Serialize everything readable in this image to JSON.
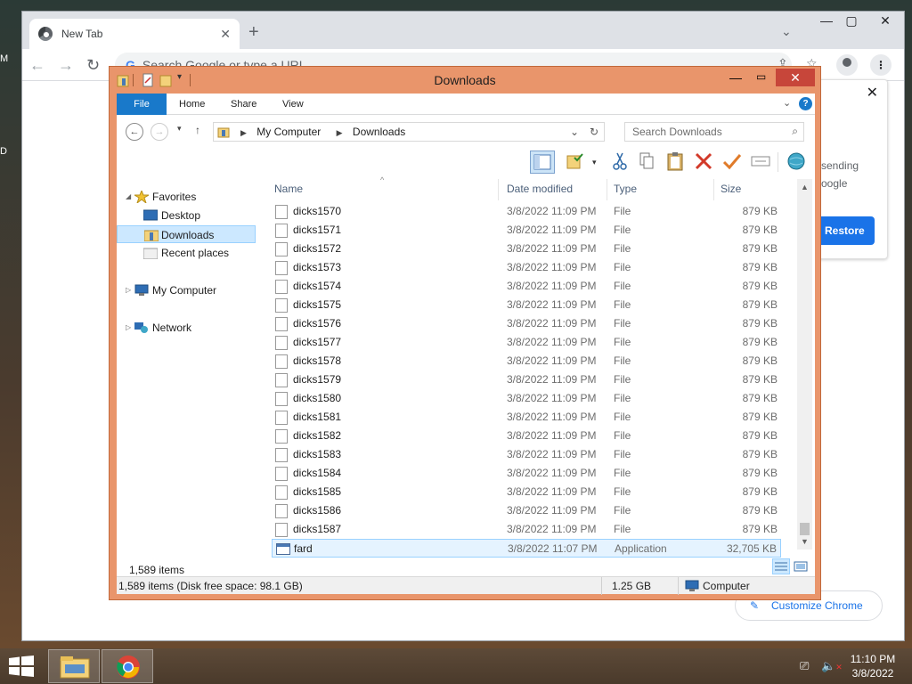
{
  "chrome": {
    "tab_title": "New Tab",
    "omnibox_placeholder": "Search Google or type a URL",
    "restore_text": [
      "sending",
      "oogle"
    ],
    "restore_label": "Restore",
    "customize_label": "Customize Chrome"
  },
  "explorer": {
    "title": "Downloads",
    "ribbon_tabs": [
      "File",
      "Home",
      "Share",
      "View"
    ],
    "breadcrumb": [
      "My Computer",
      "Downloads"
    ],
    "search_placeholder": "Search Downloads",
    "nav": {
      "favorites": "Favorites",
      "desktop": "Desktop",
      "downloads": "Downloads",
      "recent": "Recent places",
      "computer": "My Computer",
      "network": "Network"
    },
    "columns": {
      "name": "Name",
      "date": "Date modified",
      "type": "Type",
      "size": "Size"
    },
    "files": [
      {
        "name": "dicks1570",
        "date": "3/8/2022 11:09 PM",
        "type": "File",
        "size": "879 KB"
      },
      {
        "name": "dicks1571",
        "date": "3/8/2022 11:09 PM",
        "type": "File",
        "size": "879 KB"
      },
      {
        "name": "dicks1572",
        "date": "3/8/2022 11:09 PM",
        "type": "File",
        "size": "879 KB"
      },
      {
        "name": "dicks1573",
        "date": "3/8/2022 11:09 PM",
        "type": "File",
        "size": "879 KB"
      },
      {
        "name": "dicks1574",
        "date": "3/8/2022 11:09 PM",
        "type": "File",
        "size": "879 KB"
      },
      {
        "name": "dicks1575",
        "date": "3/8/2022 11:09 PM",
        "type": "File",
        "size": "879 KB"
      },
      {
        "name": "dicks1576",
        "date": "3/8/2022 11:09 PM",
        "type": "File",
        "size": "879 KB"
      },
      {
        "name": "dicks1577",
        "date": "3/8/2022 11:09 PM",
        "type": "File",
        "size": "879 KB"
      },
      {
        "name": "dicks1578",
        "date": "3/8/2022 11:09 PM",
        "type": "File",
        "size": "879 KB"
      },
      {
        "name": "dicks1579",
        "date": "3/8/2022 11:09 PM",
        "type": "File",
        "size": "879 KB"
      },
      {
        "name": "dicks1580",
        "date": "3/8/2022 11:09 PM",
        "type": "File",
        "size": "879 KB"
      },
      {
        "name": "dicks1581",
        "date": "3/8/2022 11:09 PM",
        "type": "File",
        "size": "879 KB"
      },
      {
        "name": "dicks1582",
        "date": "3/8/2022 11:09 PM",
        "type": "File",
        "size": "879 KB"
      },
      {
        "name": "dicks1583",
        "date": "3/8/2022 11:09 PM",
        "type": "File",
        "size": "879 KB"
      },
      {
        "name": "dicks1584",
        "date": "3/8/2022 11:09 PM",
        "type": "File",
        "size": "879 KB"
      },
      {
        "name": "dicks1585",
        "date": "3/8/2022 11:09 PM",
        "type": "File",
        "size": "879 KB"
      },
      {
        "name": "dicks1586",
        "date": "3/8/2022 11:09 PM",
        "type": "File",
        "size": "879 KB"
      },
      {
        "name": "dicks1587",
        "date": "3/8/2022 11:09 PM",
        "type": "File",
        "size": "879 KB"
      },
      {
        "name": "fard",
        "date": "3/8/2022 11:07 PM",
        "type": "Application",
        "size": "32,705 KB",
        "selected": true
      }
    ],
    "items_count": "1,589 items",
    "status": {
      "summary": "1,589 items (Disk free space: 98.1 GB)",
      "size": "1.25 GB",
      "location": "Computer"
    }
  },
  "taskbar": {
    "clock_time": "11:10 PM",
    "clock_date": "3/8/2022"
  },
  "desktop_edge_labels": [
    "M",
    "D"
  ],
  "colors": {
    "explorer_frame": "#e9956b",
    "file_tab": "#1979ca",
    "chrome_accent": "#1a73e8",
    "close_red": "#c7463a"
  }
}
